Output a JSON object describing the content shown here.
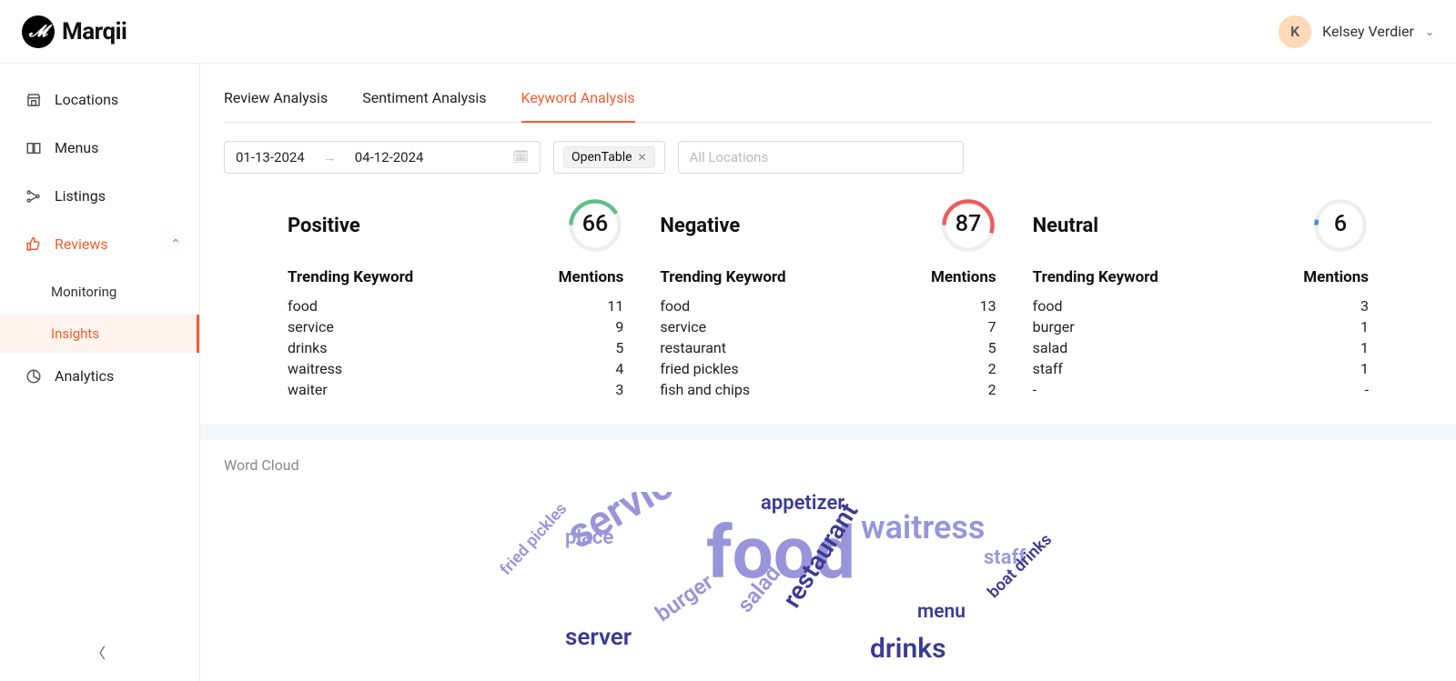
{
  "header": {
    "brand": "Marqii",
    "user_initial": "K",
    "user_name": "Kelsey Verdier"
  },
  "sidebar": {
    "items": [
      {
        "label": "Locations"
      },
      {
        "label": "Menus"
      },
      {
        "label": "Listings"
      },
      {
        "label": "Reviews"
      },
      {
        "label": "Analytics"
      }
    ],
    "subitems": [
      {
        "label": "Monitoring"
      },
      {
        "label": "Insights"
      }
    ]
  },
  "tabs": {
    "t1": "Review Analysis",
    "t2": "Sentiment Analysis",
    "t3": "Keyword Analysis"
  },
  "filters": {
    "date_from": "01-13-2024",
    "date_to": "04-12-2024",
    "source_tag": "OpenTable",
    "locations_placeholder": "All Locations"
  },
  "table_headers": {
    "keyword": "Trending Keyword",
    "mentions": "Mentions"
  },
  "sentiments": {
    "positive": {
      "title": "Positive",
      "count": "66",
      "rows": [
        {
          "k": "food",
          "v": "11"
        },
        {
          "k": "service",
          "v": "9"
        },
        {
          "k": "drinks",
          "v": "5"
        },
        {
          "k": "waitress",
          "v": "4"
        },
        {
          "k": "waiter",
          "v": "3"
        }
      ]
    },
    "negative": {
      "title": "Negative",
      "count": "87",
      "rows": [
        {
          "k": "food",
          "v": "13"
        },
        {
          "k": "service",
          "v": "7"
        },
        {
          "k": "restaurant",
          "v": "5"
        },
        {
          "k": "fried pickles",
          "v": "2"
        },
        {
          "k": "fish and chips",
          "v": "2"
        }
      ]
    },
    "neutral": {
      "title": "Neutral",
      "count": "6",
      "rows": [
        {
          "k": "food",
          "v": "3"
        },
        {
          "k": "burger",
          "v": "1"
        },
        {
          "k": "salad",
          "v": "1"
        },
        {
          "k": "staff",
          "v": "1"
        },
        {
          "k": "-",
          "v": "-"
        }
      ]
    }
  },
  "wordcloud_title": "Word Cloud",
  "cloud_words": {
    "w0": "appetizer",
    "w1": "place",
    "w2": "waitress",
    "w3": "service",
    "w4": "food",
    "w5": "staff",
    "w6": "fried pickles",
    "w7": "server",
    "w8": "burger",
    "w9": "salad",
    "w10": "restaurant",
    "w11": "menu",
    "w12": "boat drinks",
    "w13": "drinks"
  }
}
